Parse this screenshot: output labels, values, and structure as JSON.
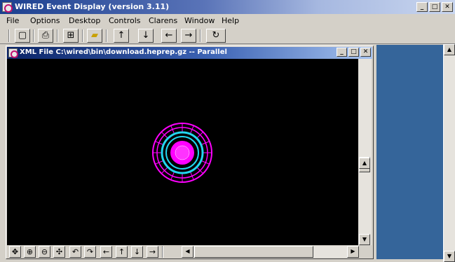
{
  "app": {
    "title": "WIRED Event Display (version 3.11)",
    "caption": {
      "minimize": "_",
      "maximize": "□",
      "close": "✕"
    }
  },
  "menu": [
    "File",
    "Options",
    "Desktop",
    "Controls",
    "Clarens",
    "Window",
    "Help"
  ],
  "toolbar": {
    "icons": [
      "new-icon",
      "print-icon",
      "tree-icon",
      "open-folder-icon",
      "arrow-up-icon",
      "arrow-down-icon",
      "arrow-left-icon",
      "arrow-right-icon",
      "rotate-icon"
    ],
    "glyphs": {
      "new": "▢",
      "print": "⎙",
      "tree": "⊞",
      "open": "▰",
      "up": "↑",
      "down": "↓",
      "left": "←",
      "right": "→",
      "rotate": "↻"
    }
  },
  "inner_window": {
    "title": "XML File C:\\wired\\bin\\download.heprep.gz -- Parallel",
    "caption": {
      "minimize": "_",
      "maximize": "□",
      "close": "✕"
    }
  },
  "nav_toolbar": {
    "glyphs": {
      "move": "✥",
      "zoom_in": "⊕",
      "zoom_out": "⊖",
      "pan": "✣",
      "rotate_ccw": "↶",
      "rotate_cw": "↷",
      "left": "←",
      "up": "↑",
      "down": "↓",
      "right": "→"
    }
  },
  "scroll": {
    "up": "▲",
    "down": "▼",
    "left": "◀",
    "right": "▶"
  },
  "colors": {
    "event_outer": "#ff00ff",
    "event_inner": "#22d6f0",
    "right_panel": "#35659a"
  }
}
